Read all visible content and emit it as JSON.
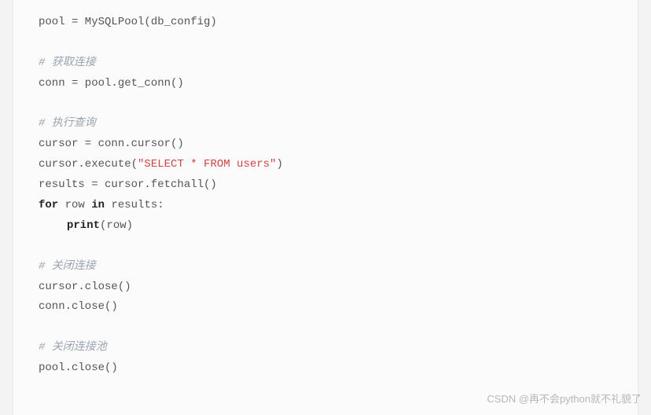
{
  "code": {
    "l1_a": "pool = MySQLPool(db_config)",
    "c1": "# 获取连接",
    "l2_a": "conn = pool.get_conn()",
    "c2": "# 执行查询",
    "l3_a": "cursor = conn.cursor()",
    "l3_b_pre": "cursor.execute(",
    "l3_b_str": "\"SELECT * FROM users\"",
    "l3_b_post": ")",
    "l3_c": "results = cursor.fetchall()",
    "l3_d_kw1": "for",
    "l3_d_mid": " row ",
    "l3_d_kw2": "in",
    "l3_d_end": " results:",
    "l3_e_fn": "print",
    "l3_e_arg": "(row)",
    "c3": "# 关闭连接",
    "l4_a": "cursor.close()",
    "l4_b": "conn.close()",
    "c4": "# 关闭连接池",
    "l5_a": "pool.close()"
  },
  "watermark": "CSDN @再不会python就不礼貌了"
}
